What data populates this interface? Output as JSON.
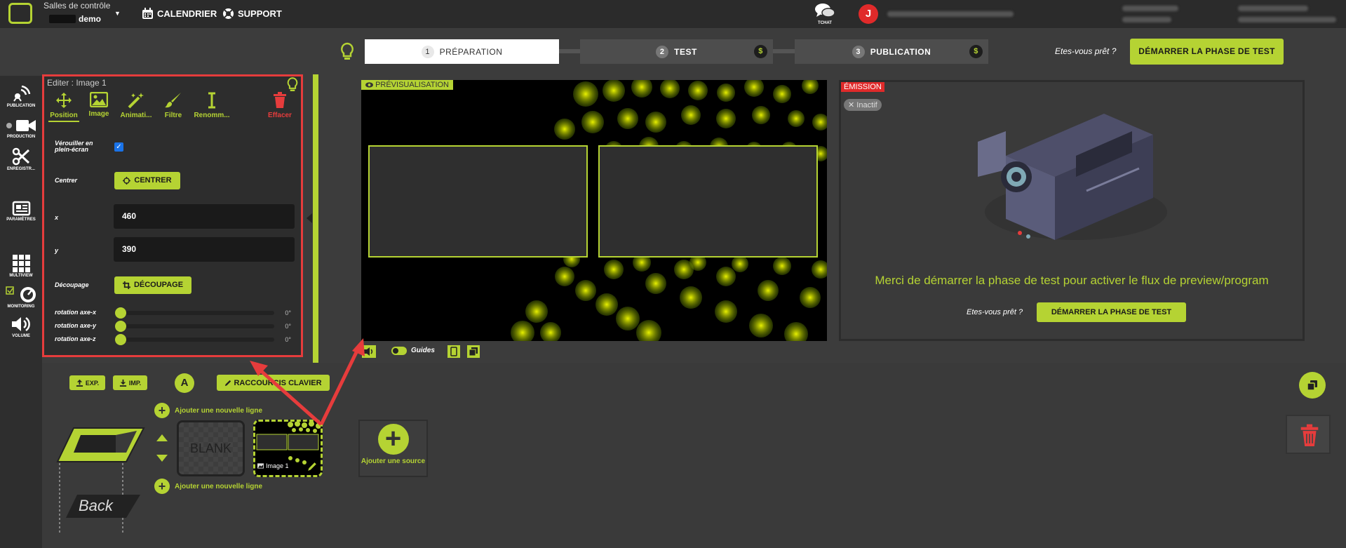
{
  "header": {
    "app_title": "Salles de contrôle",
    "account": "demo",
    "nav": [
      {
        "label": "CALENDRIER"
      },
      {
        "label": "SUPPORT"
      }
    ],
    "chat_label": "TCHAT",
    "avatar_initial": "J"
  },
  "steps": [
    {
      "num": "1",
      "label": "PRÉPARATION",
      "state": "active"
    },
    {
      "num": "2",
      "label": "TEST",
      "badge": "$"
    },
    {
      "num": "3",
      "label": "PUBLICATION",
      "badge": "$"
    }
  ],
  "ready_prompt": "Etes-vous prêt ?",
  "start_test_label": "DÉMARRER LA PHASE DE TEST",
  "sidebar": [
    {
      "label": "PUBLICATION",
      "icon": "broadcast-icon"
    },
    {
      "label": "PRODUCTION",
      "icon": "video-camera-icon"
    },
    {
      "label": "ENREGISTR...",
      "icon": "scissors-icon"
    },
    {
      "label": "PARAMÈTRES",
      "icon": "newspaper-icon"
    },
    {
      "label": "MULTIVIEW",
      "icon": "grid-icon"
    },
    {
      "label": "MONITORING",
      "icon": "gauge-icon"
    },
    {
      "label": "VOLUME",
      "icon": "volume-icon"
    }
  ],
  "editor": {
    "title": "Editer : Image 1",
    "tools": [
      {
        "label": "Position",
        "icon": "move-icon",
        "active": true
      },
      {
        "label": "Image",
        "icon": "image-icon"
      },
      {
        "label": "Animati...",
        "icon": "magic-wand-icon"
      },
      {
        "label": "Filtre",
        "icon": "brush-icon"
      },
      {
        "label": "Renomm...",
        "icon": "text-cursor-icon"
      },
      {
        "label": "Effacer",
        "icon": "trash-icon",
        "color": "#e63c3c"
      }
    ],
    "lock_label": "Vérouiller en plein-écran",
    "lock_checked": true,
    "center_label": "Centrer",
    "center_button": "CENTRER",
    "x_label": "x",
    "x_value": "460",
    "y_label": "y",
    "y_value": "390",
    "crop_label": "Découpage",
    "crop_button": "DÉCOUPAGE",
    "rotations": [
      {
        "label": "rotation axe-x",
        "value": "0°"
      },
      {
        "label": "rotation axe-y",
        "value": "0°"
      },
      {
        "label": "rotation axe-z",
        "value": "0°"
      }
    ]
  },
  "preview": {
    "label": "PRÉVISUALISATION",
    "guides_label": "Guides"
  },
  "program": {
    "label": "ÉMISSION",
    "status": "Inactif",
    "message": "Merci de démarrer la phase de test pour activer le flux de preview/program",
    "ready_prompt": "Etes-vous prêt ?",
    "start_button": "DÉMARRER LA PHASE DE TEST"
  },
  "bottom": {
    "exp_label": "EXP.",
    "imp_label": "IMP.",
    "a_label": "A",
    "shortcuts_label": "RACCOURCIS CLAVIER",
    "add_line_label": "Ajouter une nouvelle ligne",
    "back_label": "Back",
    "blank_label": "BLANK",
    "image_label": "Image 1",
    "add_source_label": "Ajouter une source"
  },
  "colors": {
    "accent": "#b5d333",
    "danger": "#e63c3c",
    "background": "#3c3c3c"
  }
}
